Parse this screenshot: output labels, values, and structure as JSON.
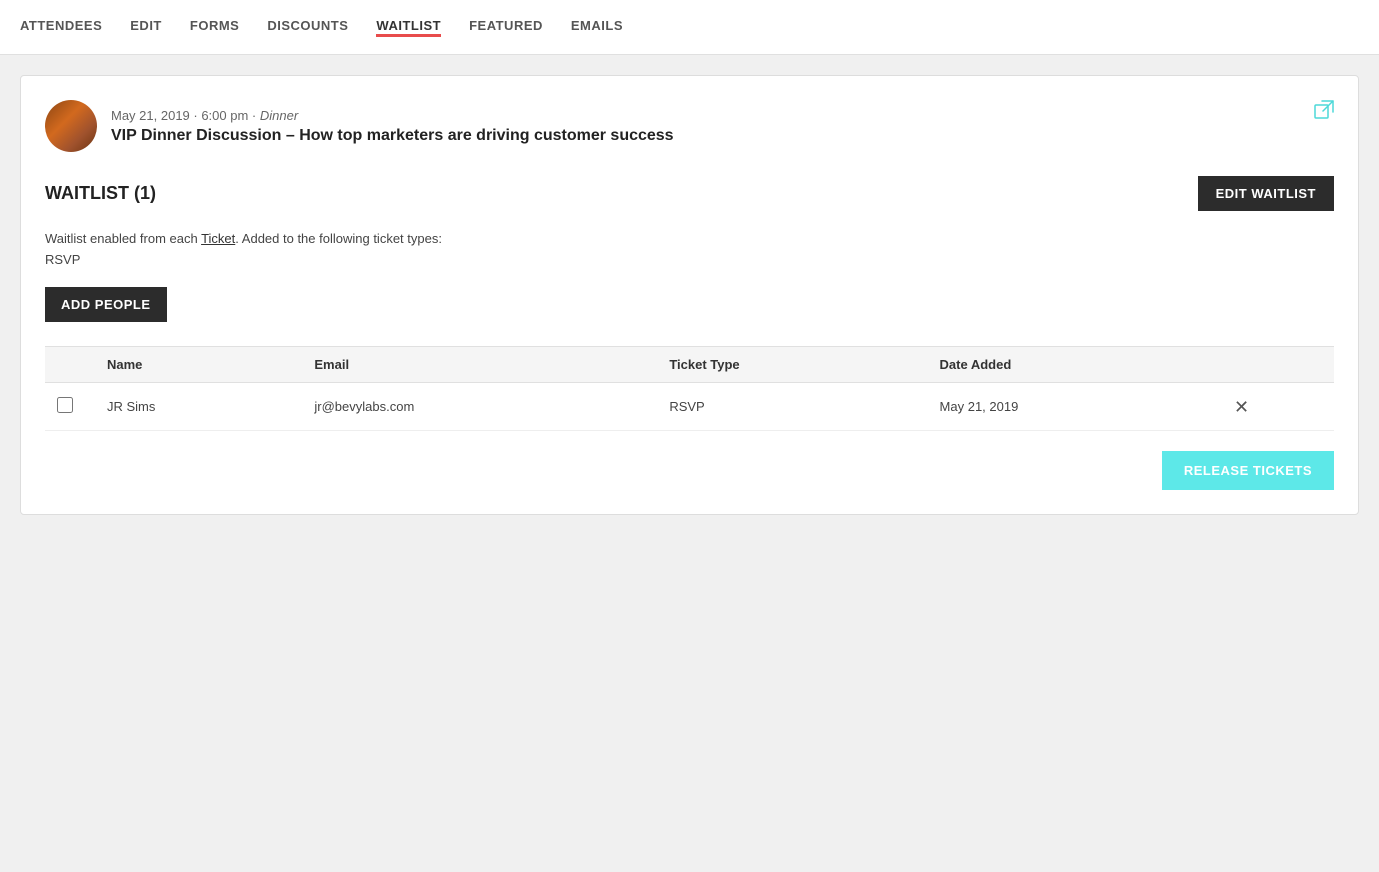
{
  "nav": {
    "items": [
      {
        "label": "ATTENDEES",
        "active": false
      },
      {
        "label": "EDIT",
        "active": false
      },
      {
        "label": "FORMS",
        "active": false
      },
      {
        "label": "DISCOUNTS",
        "active": false
      },
      {
        "label": "WAITLIST",
        "active": true
      },
      {
        "label": "FEATURED",
        "active": false
      },
      {
        "label": "EMAILS",
        "active": false
      }
    ]
  },
  "event": {
    "date": "May 21, 2019 · 6:00 pm · ",
    "type": "Dinner",
    "title": "VIP Dinner Discussion – How top marketers are driving customer success"
  },
  "waitlist": {
    "title": "WAITLIST (1)",
    "edit_button": "EDIT WAITLIST",
    "info_text": "Waitlist enabled from each ",
    "ticket_link": "Ticket",
    "info_text_suffix": ". Added to the following ticket types:",
    "ticket_type": "RSVP",
    "add_button": "ADD PEOPLE",
    "table": {
      "columns": [
        "Name",
        "Email",
        "Ticket Type",
        "Date Added"
      ],
      "rows": [
        {
          "name": "JR Sims",
          "email": "jr@bevylabs.com",
          "ticket_type": "RSVP",
          "date_added": "May 21, 2019"
        }
      ]
    },
    "release_button": "RELEASE TICKETS"
  },
  "icons": {
    "external_link": "⧉",
    "close": "✕"
  },
  "colors": {
    "active_tab_border": "#e84c4c",
    "teal": "#5de8e8",
    "dark_button": "#2c2c2c"
  }
}
